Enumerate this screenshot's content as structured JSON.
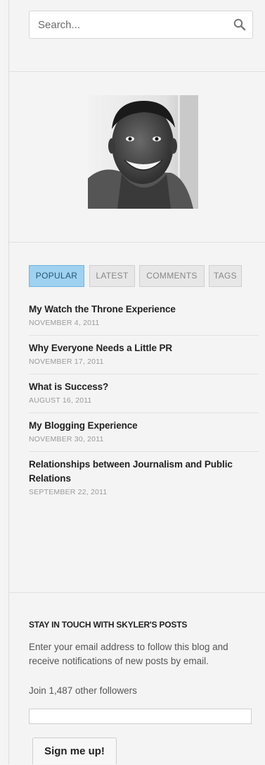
{
  "search": {
    "placeholder": "Search...",
    "icon": "search-icon"
  },
  "avatar": {
    "description_icon": "avatar"
  },
  "tabs": [
    {
      "label": "POPULAR",
      "active": true
    },
    {
      "label": "LATEST",
      "active": false
    },
    {
      "label": "COMMENTS",
      "active": false
    },
    {
      "label": "TAGS",
      "active": false
    }
  ],
  "posts": [
    {
      "title": "My Watch the Throne Experience",
      "date": "NOVEMBER 4, 2011"
    },
    {
      "title": "Why Everyone Needs a Little PR",
      "date": "NOVEMBER 17, 2011"
    },
    {
      "title": "What is Success?",
      "date": "AUGUST 16, 2011"
    },
    {
      "title": "My Blogging Experience",
      "date": "NOVEMBER 30, 2011"
    },
    {
      "title": "Relationships between Journalism and Public Relations",
      "date": "SEPTEMBER 22, 2011"
    }
  ],
  "follow": {
    "heading": "STAY IN TOUCH WITH SKYLER'S POSTS",
    "description": "Enter your email address to follow this blog and receive notifications of new posts by email.",
    "followers": "Join 1,487 other followers",
    "email_value": "",
    "button_label": "Sign me up!"
  },
  "colors": {
    "background": "#f4f4f4",
    "active_tab": "#9fd1f0",
    "active_tab_border": "#6eb4e0"
  }
}
